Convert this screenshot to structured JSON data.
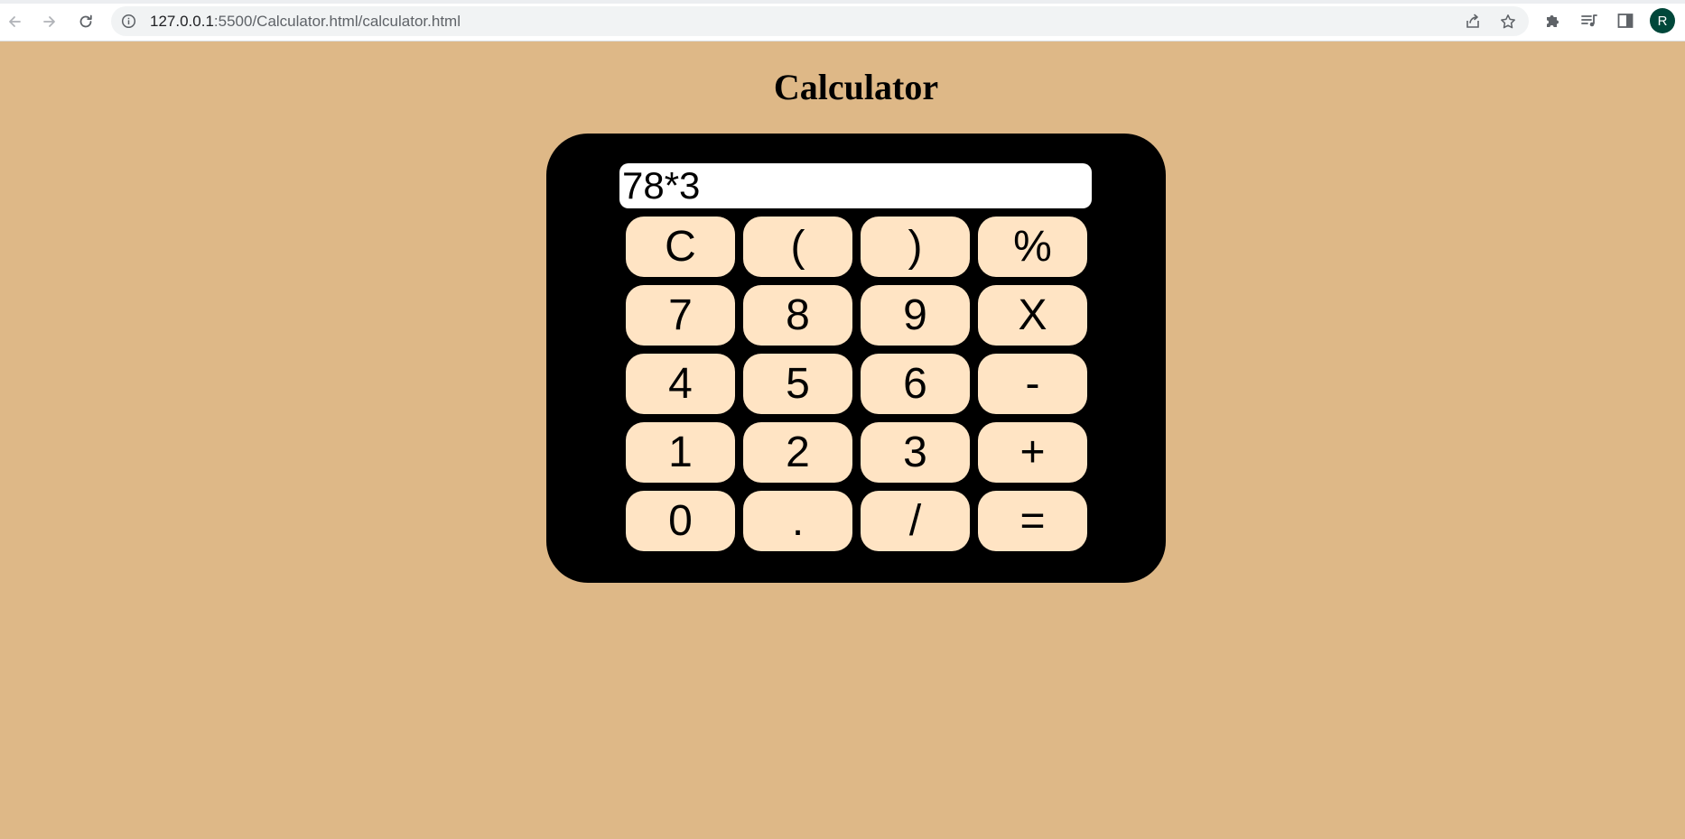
{
  "browser": {
    "url_host": "127.0.0.1",
    "url_path": ":5500/Calculator.html/calculator.html",
    "profile_initial": "R",
    "icons": {
      "back": "arrow-left-icon",
      "forward": "arrow-right-icon",
      "reload": "reload-icon",
      "info": "info-icon",
      "share": "share-icon",
      "bookmark": "star-icon",
      "extensions": "puzzle-icon",
      "reading_list": "reading-list-icon",
      "side_panel": "side-panel-icon"
    }
  },
  "page": {
    "title": "Calculator",
    "background_color": "#deb887"
  },
  "calculator": {
    "display_value": "78*3",
    "body_color": "#000000",
    "key_color": "#ffe4c4",
    "keys": [
      {
        "label": "C",
        "name": "clear-button"
      },
      {
        "label": "(",
        "name": "open-paren-button"
      },
      {
        "label": ")",
        "name": "close-paren-button"
      },
      {
        "label": "%",
        "name": "percent-button"
      },
      {
        "label": "7",
        "name": "digit-7-button"
      },
      {
        "label": "8",
        "name": "digit-8-button"
      },
      {
        "label": "9",
        "name": "digit-9-button"
      },
      {
        "label": "X",
        "name": "multiply-button"
      },
      {
        "label": "4",
        "name": "digit-4-button"
      },
      {
        "label": "5",
        "name": "digit-5-button"
      },
      {
        "label": "6",
        "name": "digit-6-button"
      },
      {
        "label": "-",
        "name": "subtract-button"
      },
      {
        "label": "1",
        "name": "digit-1-button"
      },
      {
        "label": "2",
        "name": "digit-2-button"
      },
      {
        "label": "3",
        "name": "digit-3-button"
      },
      {
        "label": "+",
        "name": "add-button"
      },
      {
        "label": "0",
        "name": "digit-0-button"
      },
      {
        "label": ".",
        "name": "decimal-button"
      },
      {
        "label": "/",
        "name": "divide-button"
      },
      {
        "label": "=",
        "name": "equals-button"
      }
    ]
  }
}
